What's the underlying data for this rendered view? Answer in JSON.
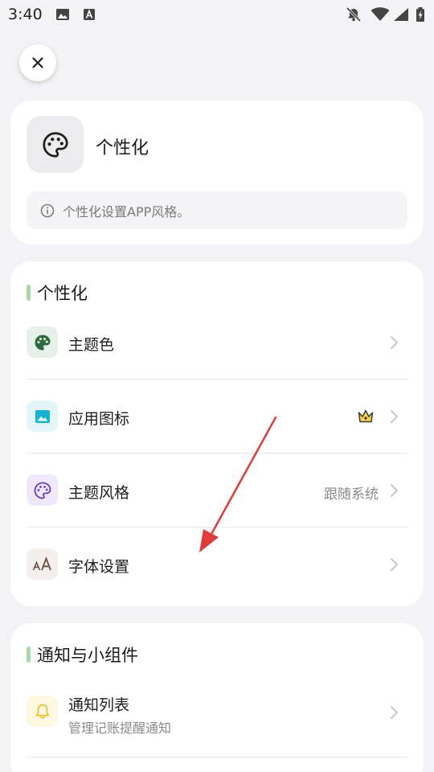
{
  "status_bar": {
    "time": "3:40",
    "icons": [
      "image-icon",
      "font-a-icon",
      "notifications-off-icon",
      "wifi-icon",
      "signal-icon",
      "battery-charging-icon"
    ]
  },
  "close_button": {
    "icon": "close-icon"
  },
  "header": {
    "icon": "palette-icon",
    "title": "个性化",
    "description": "个性化设置APP风格。",
    "info_icon": "info-icon"
  },
  "sections": [
    {
      "title": "个性化",
      "items": [
        {
          "label": "主题色",
          "icon": "palette-icon",
          "icon_color": "#2e6b3f",
          "icon_bg": "#e7f0e8"
        },
        {
          "label": "应用图标",
          "icon": "image-icon",
          "icon_color": "#15b3d1",
          "icon_bg": "#e2f6fa",
          "badge_icon": "crown-icon"
        },
        {
          "label": "主题风格",
          "icon": "palette-icon",
          "icon_color": "#6a3bc2",
          "icon_bg": "#efe8fa",
          "value": "跟随系统"
        },
        {
          "label": "字体设置",
          "icon": "font-aa-icon",
          "icon_color": "#6b4f45",
          "icon_bg": "#f4eeec",
          "icon_text": "AA"
        }
      ]
    },
    {
      "title": "通知与小组件",
      "items": [
        {
          "label": "通知列表",
          "sublabel": "管理记账提醒通知",
          "icon": "bell-icon",
          "icon_color": "#e8c02a",
          "icon_bg": "#fdf8df"
        }
      ]
    }
  ],
  "accent_colors": {
    "section_bar": "#a6d9a8",
    "annotation_arrow": "#e03a3a"
  }
}
